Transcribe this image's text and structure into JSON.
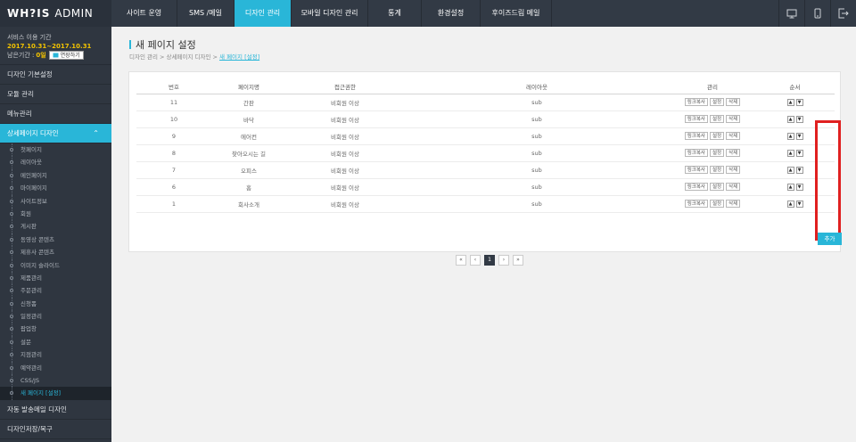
{
  "header": {
    "logo": "WH?IS",
    "admin": "ADMIN",
    "nav": [
      {
        "label": "사이트 운영",
        "w": 74
      },
      {
        "label": "SMS /메일",
        "w": 64
      },
      {
        "label": "디자인 관리",
        "w": 64
      },
      {
        "label": "모바일 디자인 관리",
        "w": 86
      },
      {
        "label": "통계",
        "w": 60
      },
      {
        "label": "환경설정",
        "w": 66
      },
      {
        "label": "후이즈드림 메일",
        "w": 80
      }
    ],
    "active_nav": 2
  },
  "sidebar": {
    "service_label": "서비스 이용 기간",
    "service_period": "2017.10.31~2017.10.31",
    "remain_label": "남은기간 :",
    "remain_value": "0일",
    "extend_button": "연장하기",
    "menus": {
      "m1": "디자인 기본설정",
      "m2": "모듈 관리",
      "m3": "메뉴관리",
      "m4": "상세페이지 디자인",
      "m5": "자동 발송메일 디자인",
      "m6": "디자인저장/복구"
    },
    "subitems": [
      "첫페이지",
      "레이아웃",
      "메인페이지",
      "마이페이지",
      "사이트정보",
      "회원",
      "게시판",
      "동영상 콘텐츠",
      "제휴사 콘텐츠",
      "이미지 슬라이드",
      "제품관리",
      "주문관리",
      "신청폼",
      "일정관리",
      "팝업창",
      "설문",
      "지점관리",
      "예약관리",
      "CSS/JS",
      "새 페이지 [설정]"
    ]
  },
  "main": {
    "title": "새 페이지 설정",
    "breadcrumb": "디자인 관리 > 상세페이지 디자인 > ",
    "breadcrumb_current": "새 페이지 [설정]",
    "columns": {
      "no": "번호",
      "name": "페이지명",
      "access": "접근권한",
      "layout": "레이아웃",
      "manage": "관리",
      "order": "순서"
    },
    "buttons": {
      "copy": "링크복사",
      "setting": "설정",
      "delete": "삭제",
      "up": "▲",
      "down": "▼"
    },
    "rows": [
      {
        "no": "11",
        "name": "간판",
        "access": "비회원 이상",
        "layout": "sub"
      },
      {
        "no": "10",
        "name": "바닥",
        "access": "비회원 이상",
        "layout": "sub"
      },
      {
        "no": "9",
        "name": "에어컨",
        "access": "비회원 이상",
        "layout": "sub"
      },
      {
        "no": "8",
        "name": "찾아오시는 길",
        "access": "비회원 이상",
        "layout": "sub"
      },
      {
        "no": "7",
        "name": "오피스",
        "access": "비회원 이상",
        "layout": "sub"
      },
      {
        "no": "6",
        "name": "홈",
        "access": "비회원 이상",
        "layout": "sub"
      },
      {
        "no": "1",
        "name": "회사소개",
        "access": "비회원 이상",
        "layout": "sub"
      }
    ],
    "add_button": "추가",
    "pager": [
      "«",
      "‹",
      "1",
      "›",
      "»"
    ],
    "current_page": "1"
  },
  "colors": {
    "accent": "#29b6d8",
    "topbar": "#323a45",
    "sidebar": "#2f3640",
    "highlight": "#e02020"
  },
  "icons": [
    "monitor-icon",
    "mobile-icon",
    "logout-icon",
    "chevron-up-icon"
  ]
}
